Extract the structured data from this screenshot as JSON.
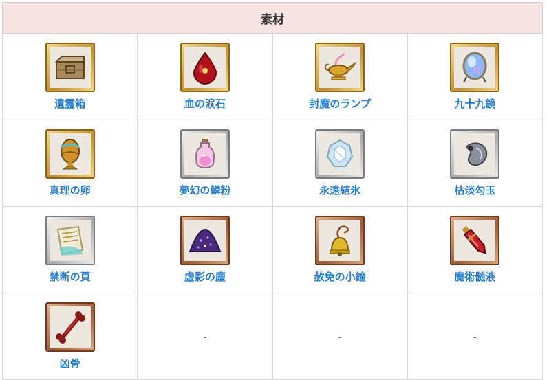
{
  "table": {
    "header": "素材",
    "rows": [
      [
        {
          "label": "遺霊箱",
          "icon": "ornate-chest-icon",
          "frame": "gold"
        },
        {
          "label": "血の涙石",
          "icon": "red-teardrop-gem-icon",
          "frame": "gold"
        },
        {
          "label": "封魔のランプ",
          "icon": "golden-magic-lamp-icon",
          "frame": "gold"
        },
        {
          "label": "九十九鏡",
          "icon": "crystal-mirror-icon",
          "frame": "gold"
        }
      ],
      [
        {
          "label": "真理の卵",
          "icon": "golden-egg-icon",
          "frame": "gold"
        },
        {
          "label": "夢幻の鱗粉",
          "icon": "pink-vial-icon",
          "frame": "silver"
        },
        {
          "label": "永遠結氷",
          "icon": "ice-crystal-icon",
          "frame": "silver"
        },
        {
          "label": "枯淡勾玉",
          "icon": "magatama-icon",
          "frame": "silver"
        }
      ],
      [
        {
          "label": "禁断の頁",
          "icon": "scroll-page-icon",
          "frame": "silver"
        },
        {
          "label": "虚影の塵",
          "icon": "purple-dust-pile-icon",
          "frame": "bronze"
        },
        {
          "label": "赦免の小鐘",
          "icon": "small-bell-icon",
          "frame": "bronze"
        },
        {
          "label": "魔術髄液",
          "icon": "red-potion-vial-icon",
          "frame": "bronze"
        }
      ],
      [
        {
          "label": "凶骨",
          "icon": "bone-icon",
          "frame": "bronze"
        },
        {
          "label": "-"
        },
        {
          "label": "-"
        },
        {
          "label": "-"
        }
      ]
    ]
  }
}
